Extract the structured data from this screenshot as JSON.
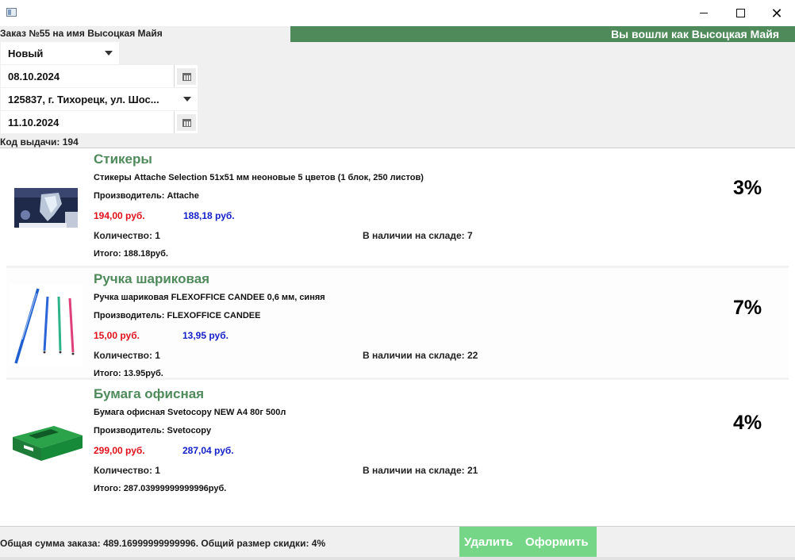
{
  "window": {
    "title": ""
  },
  "header": {
    "order_title": "Заказ №55 на имя Высоцкая Майя",
    "user_banner": "Вы вошли как Высоцкая Майя"
  },
  "form": {
    "status": "Новый",
    "order_date": "08.10.2024",
    "address": "125837, г. Тихорецк, ул. Шос...",
    "delivery_date": "11.10.2024",
    "pickup_code": "Код выдачи: 194"
  },
  "items": [
    {
      "name": "Стикеры",
      "description": "Стикеры Attache Selection 51x51 мм неоновые 5 цветов (1 блок, 250 листов)",
      "manufacturer": "Производитель: Attache",
      "price_old": "194,00 руб.",
      "price_new": "188,18 руб.",
      "quantity": "Количество: 1",
      "stock": "В наличии на складе: 7",
      "total": "Итого: 188.18руб.",
      "discount": "3%"
    },
    {
      "name": "Ручка шариковая",
      "description": "Ручка шариковая FLEXOFFICE CANDEE 0,6 мм, синяя",
      "manufacturer": "Производитель: FLEXOFFICE CANDEE",
      "price_old": "15,00 руб.",
      "price_new": "13,95 руб.",
      "quantity": "Количество: 1",
      "stock": "В наличии на складе: 22",
      "total": "Итого: 13.95руб.",
      "discount": "7%"
    },
    {
      "name": "Бумага офисная",
      "description": "Бумага офисная Svetocopy NEW A4 80г 500л",
      "manufacturer": "Производитель: Svetocopy",
      "price_old": "299,00 руб.",
      "price_new": "287,04 руб.",
      "quantity": "Количество: 1",
      "stock": "В наличии на складе: 21",
      "total": "Итого: 287.03999999999996руб.",
      "discount": "4%"
    }
  ],
  "footer": {
    "summary": "Общая сумма заказа: 489.16999999999996. Общий размер скидки: 4%",
    "delete_label": "Удалить",
    "checkout_label": "Оформить"
  },
  "colors": {
    "accent_green": "#4f8a5b",
    "button_green": "#76d687",
    "price_old": "#e0101a",
    "price_new": "#1420c8"
  },
  "icons": {
    "app": "app-icon",
    "minimize": "minimize-icon",
    "maximize": "maximize-icon",
    "close": "close-icon",
    "calendar": "calendar-icon",
    "dropdown": "chevron-down-icon"
  }
}
